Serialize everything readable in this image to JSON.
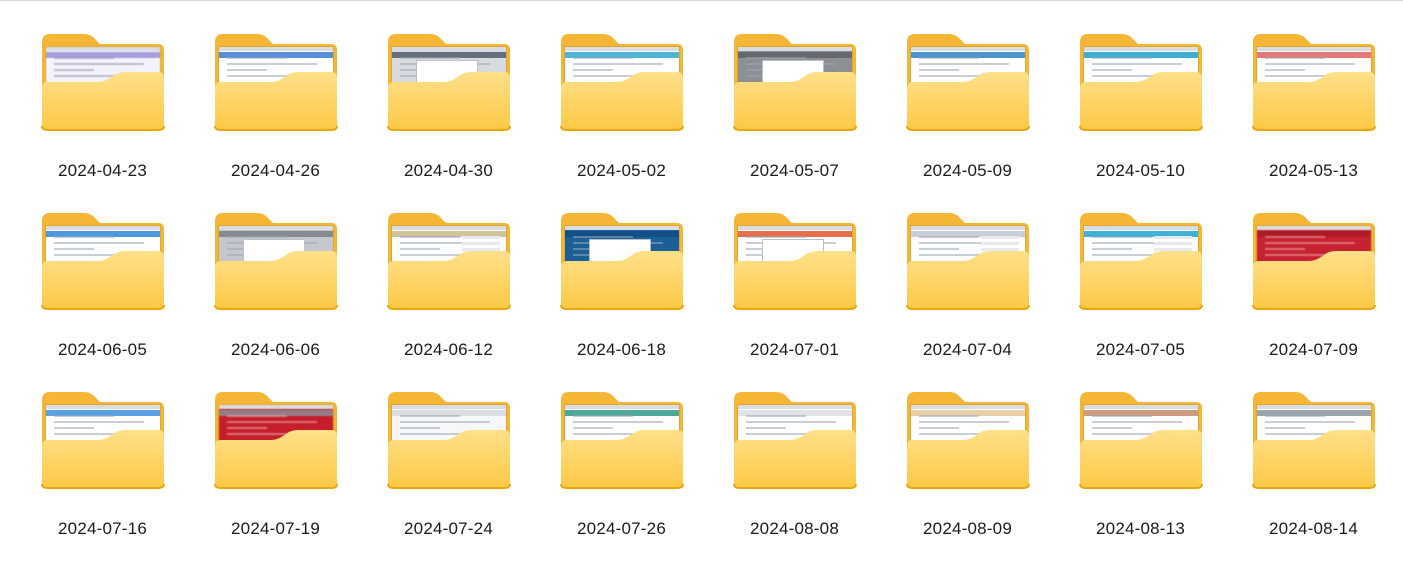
{
  "colors": {
    "folder_back": "#F4B634",
    "folder_front_top": "#FFE08A",
    "folder_front_bottom": "#FCC945",
    "folder_edge": "#E9A60E"
  },
  "folders": [
    {
      "name": "2024-04-23",
      "icon": "folder-icon",
      "thumb": {
        "bg": "#f2f3fb",
        "band": "#9a8fd6",
        "style": "blurred-text"
      }
    },
    {
      "name": "2024-04-26",
      "icon": "folder-icon",
      "thumb": {
        "bg": "#ffffff",
        "band": "#3b7bd3",
        "style": "webpage"
      }
    },
    {
      "name": "2024-04-30",
      "icon": "folder-icon",
      "thumb": {
        "bg": "#d7dbe0",
        "band": "#4f5c6b",
        "style": "dialog"
      }
    },
    {
      "name": "2024-05-02",
      "icon": "folder-icon",
      "thumb": {
        "bg": "#ffffff",
        "band": "#2fa8cf",
        "style": "webpage"
      }
    },
    {
      "name": "2024-05-07",
      "icon": "folder-icon",
      "thumb": {
        "bg": "#8c8f93",
        "band": "#5f6266",
        "style": "dialog"
      }
    },
    {
      "name": "2024-05-09",
      "icon": "folder-icon",
      "thumb": {
        "bg": "#ffffff",
        "band": "#2b83c7",
        "style": "webpage"
      }
    },
    {
      "name": "2024-05-10",
      "icon": "folder-icon",
      "thumb": {
        "bg": "#ffffff",
        "band": "#1aa0c9",
        "style": "webpage"
      }
    },
    {
      "name": "2024-05-13",
      "icon": "folder-icon",
      "thumb": {
        "bg": "#ffffff",
        "band": "#e06060",
        "style": "text"
      }
    },
    {
      "name": "2024-06-05",
      "icon": "folder-icon",
      "thumb": {
        "bg": "#ffffff",
        "band": "#2f86d8",
        "style": "webpage"
      }
    },
    {
      "name": "2024-06-06",
      "icon": "folder-icon",
      "thumb": {
        "bg": "#c4c8cd",
        "band": "#7b8087",
        "style": "dialog"
      }
    },
    {
      "name": "2024-06-12",
      "icon": "folder-icon",
      "thumb": {
        "bg": "#ffffff",
        "band": "#c9b98a",
        "style": "table"
      }
    },
    {
      "name": "2024-06-18",
      "icon": "folder-icon",
      "thumb": {
        "bg": "#1b5f97",
        "band": "#0f4c82",
        "style": "dialog"
      }
    },
    {
      "name": "2024-07-01",
      "icon": "folder-icon",
      "thumb": {
        "bg": "#ffffff",
        "band": "#e0562b",
        "style": "dialog"
      }
    },
    {
      "name": "2024-07-04",
      "icon": "folder-icon",
      "thumb": {
        "bg": "#ffffff",
        "band": "#bfc7d1",
        "style": "table"
      }
    },
    {
      "name": "2024-07-05",
      "icon": "folder-icon",
      "thumb": {
        "bg": "#ffffff",
        "band": "#1ba6d4",
        "style": "table"
      }
    },
    {
      "name": "2024-07-09",
      "icon": "folder-icon",
      "thumb": {
        "bg": "#c8212f",
        "band": "#a91a27",
        "style": "blurred"
      }
    },
    {
      "name": "2024-07-16",
      "icon": "folder-icon",
      "thumb": {
        "bg": "#ffffff",
        "band": "#3d8fe0",
        "style": "webpage"
      }
    },
    {
      "name": "2024-07-19",
      "icon": "folder-icon",
      "thumb": {
        "bg": "#c51f2b",
        "band": "#8a8f96",
        "style": "blurred"
      }
    },
    {
      "name": "2024-07-24",
      "icon": "folder-icon",
      "thumb": {
        "bg": "#f6f7f9",
        "band": "#d5d9de",
        "style": "webpage"
      }
    },
    {
      "name": "2024-07-26",
      "icon": "folder-icon",
      "thumb": {
        "bg": "#ffffff",
        "band": "#2e9a8a",
        "style": "text"
      }
    },
    {
      "name": "2024-08-08",
      "icon": "folder-icon",
      "thumb": {
        "bg": "#ffffff",
        "band": "#d9dde3",
        "style": "webpage"
      }
    },
    {
      "name": "2024-08-09",
      "icon": "folder-icon",
      "thumb": {
        "bg": "#ffffff",
        "band": "#e3c79a",
        "style": "webpage"
      }
    },
    {
      "name": "2024-08-13",
      "icon": "folder-icon",
      "thumb": {
        "bg": "#ffffff",
        "band": "#c38b6a",
        "style": "webpage"
      }
    },
    {
      "name": "2024-08-14",
      "icon": "folder-icon",
      "thumb": {
        "bg": "#ffffff",
        "band": "#8b949e",
        "style": "webpage"
      }
    }
  ]
}
